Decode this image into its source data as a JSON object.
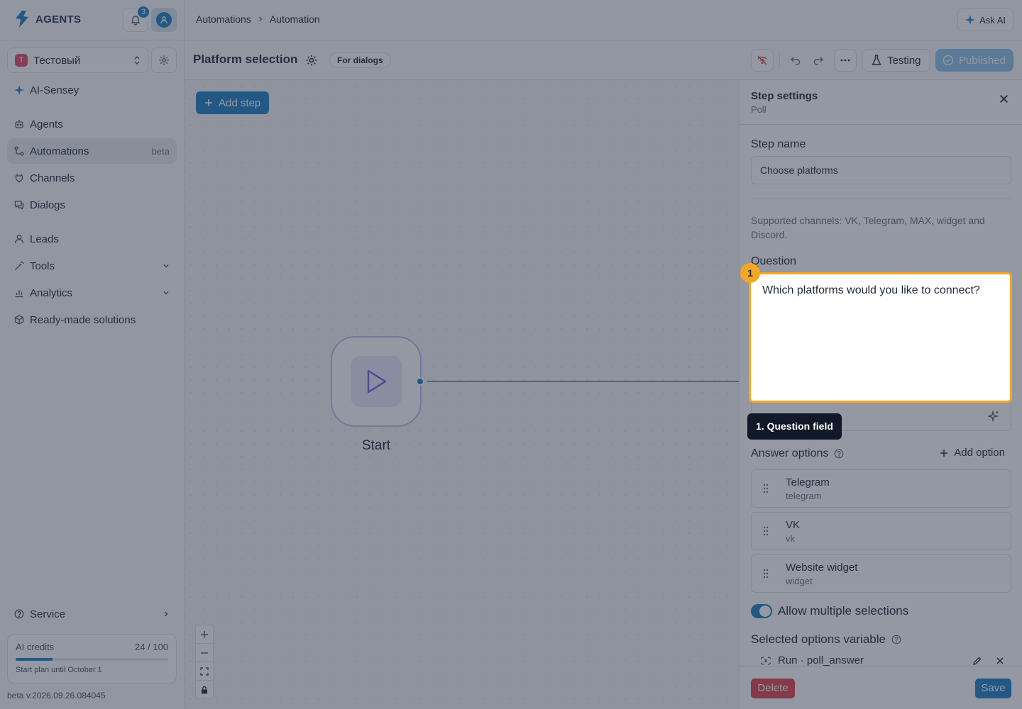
{
  "app": {
    "logo_text": "AGENTS",
    "notification_count": "3"
  },
  "workspace": {
    "badge": "Т",
    "name": "Тестовый"
  },
  "sidebar": {
    "items": [
      {
        "label": "AI-Sensey"
      },
      {
        "label": "Agents"
      },
      {
        "label": "Automations",
        "tag": "beta"
      },
      {
        "label": "Channels"
      },
      {
        "label": "Dialogs"
      },
      {
        "label": "Leads"
      },
      {
        "label": "Tools"
      },
      {
        "label": "Analytics"
      },
      {
        "label": "Ready-made solutions"
      }
    ],
    "service_label": "Service",
    "credits": {
      "label": "AI credits",
      "value": "24 / 100",
      "fraction": 0.24,
      "plan": "Start plan until October 1"
    },
    "version": "beta v.2026.09.26.084045"
  },
  "topbar": {
    "breadcrumbs": [
      "Automations",
      "Automation"
    ],
    "ask_ai": "Ask AI"
  },
  "automation": {
    "title": "Platform selection",
    "chip": "For dialogs",
    "testing_label": "Testing",
    "published_label": "Published"
  },
  "canvas": {
    "add_step_label": "Add step",
    "start_label": "Start"
  },
  "panel": {
    "title": "Step settings",
    "subtitle": "Poll",
    "step_name_label": "Step name",
    "step_name_value": "Choose platforms",
    "help_text": "Supported channels: VK, Telegram, MAX, widget and Discord.",
    "question_label": "Question",
    "question_value": "Which platforms would you like to connect?",
    "answer_options_label": "Answer options",
    "add_option_label": "Add option",
    "options": [
      {
        "label": "Telegram",
        "code": "telegram"
      },
      {
        "label": "VK",
        "code": "vk"
      },
      {
        "label": "Website widget",
        "code": "widget"
      }
    ],
    "allow_multiple_label": "Allow multiple selections",
    "allow_multiple": true,
    "variable_label": "Selected options variable",
    "variable_value": "Run · poll_answer",
    "delete_label": "Delete",
    "save_label": "Save"
  },
  "highlight": {
    "badge": "1",
    "tooltip": "1. Question field",
    "color": "#f5a623"
  },
  "colors": {
    "accent": "#1f7fc4",
    "danger": "#e0424a",
    "start_node": "#7b5ce0"
  }
}
